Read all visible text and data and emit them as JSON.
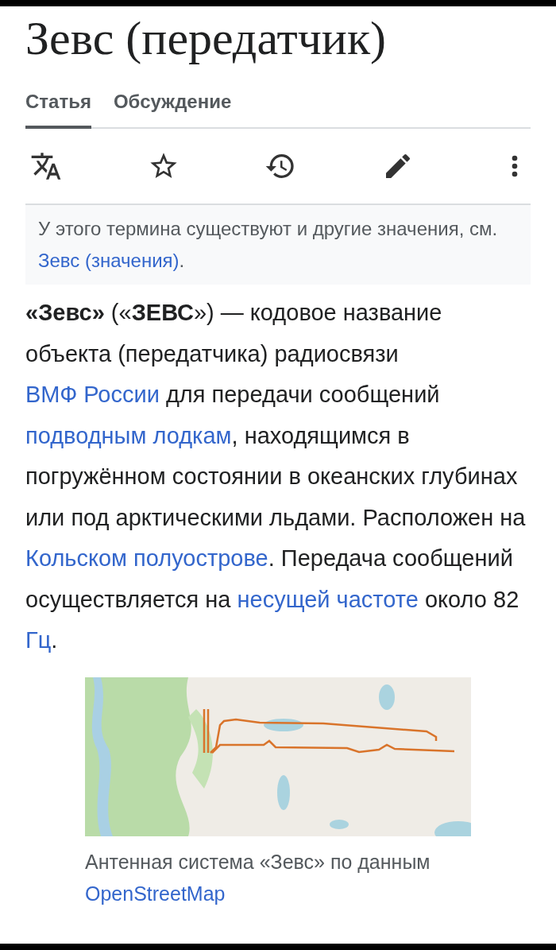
{
  "title": "Зевс (передатчик)",
  "tabs": [
    {
      "label": "Статья",
      "selected": true
    },
    {
      "label": "Обсуждение",
      "selected": false
    }
  ],
  "toolbar": [
    {
      "kind": "translate"
    },
    {
      "kind": "star"
    },
    {
      "kind": "history"
    },
    {
      "kind": "edit"
    },
    {
      "kind": "more"
    }
  ],
  "hatnote": [
    {
      "kind": "text",
      "text": "У этого термина существуют и другие значения, см. "
    },
    {
      "kind": "link",
      "text": "Зевс (значения)"
    },
    {
      "kind": "text",
      "text": "."
    }
  ],
  "paragraph": [
    {
      "kind": "text",
      "text": "**«Зевс»** («**ЗЕВС**») — кодовое название объекта (передатчика) радиосвязи "
    },
    {
      "kind": "link",
      "text": "ВМФ России"
    },
    {
      "kind": "text",
      "text": " для передачи сообщений "
    },
    {
      "kind": "link",
      "text": "подводным лодкам"
    },
    {
      "kind": "text",
      "text": ", находящимся в погружённом состоянии в океанских глубинах или под арктическими льдами. Расположен на "
    },
    {
      "kind": "link",
      "text": "Кольском полуострове"
    },
    {
      "kind": "text",
      "text": ". Передача сообщений осуществляется на "
    },
    {
      "kind": "link",
      "text": "несущей частоте"
    },
    {
      "kind": "text",
      "text": " около 82 "
    },
    {
      "kind": "link",
      "text": "Гц"
    },
    {
      "kind": "text",
      "text": "."
    }
  ],
  "figure": {
    "kind": "picture",
    "caption": [
      {
        "kind": "text",
        "text": "Антенная система «Зевс» по данным "
      },
      {
        "kind": "link",
        "text": "OpenStreetMap"
      }
    ]
  }
}
